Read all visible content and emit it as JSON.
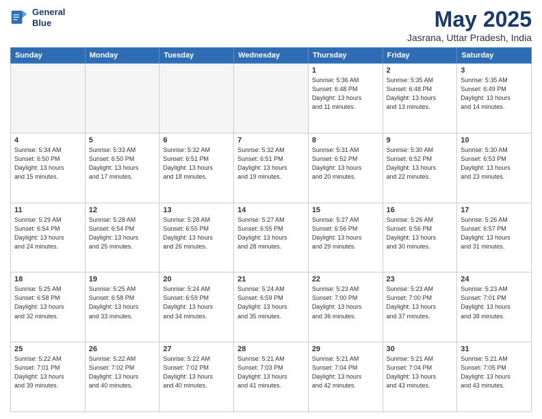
{
  "header": {
    "logo_line1": "General",
    "logo_line2": "Blue",
    "month": "May 2025",
    "location": "Jasrana, Uttar Pradesh, India"
  },
  "days_of_week": [
    "Sunday",
    "Monday",
    "Tuesday",
    "Wednesday",
    "Thursday",
    "Friday",
    "Saturday"
  ],
  "weeks": [
    [
      {
        "day": "",
        "empty": true
      },
      {
        "day": "",
        "empty": true
      },
      {
        "day": "",
        "empty": true
      },
      {
        "day": "",
        "empty": true
      },
      {
        "day": "1",
        "info": "Sunrise: 5:36 AM\nSunset: 6:48 PM\nDaylight: 13 hours\nand 11 minutes."
      },
      {
        "day": "2",
        "info": "Sunrise: 5:35 AM\nSunset: 6:48 PM\nDaylight: 13 hours\nand 13 minutes."
      },
      {
        "day": "3",
        "info": "Sunrise: 5:35 AM\nSunset: 6:49 PM\nDaylight: 13 hours\nand 14 minutes."
      }
    ],
    [
      {
        "day": "4",
        "info": "Sunrise: 5:34 AM\nSunset: 6:50 PM\nDaylight: 13 hours\nand 15 minutes."
      },
      {
        "day": "5",
        "info": "Sunrise: 5:33 AM\nSunset: 6:50 PM\nDaylight: 13 hours\nand 17 minutes."
      },
      {
        "day": "6",
        "info": "Sunrise: 5:32 AM\nSunset: 6:51 PM\nDaylight: 13 hours\nand 18 minutes."
      },
      {
        "day": "7",
        "info": "Sunrise: 5:32 AM\nSunset: 6:51 PM\nDaylight: 13 hours\nand 19 minutes."
      },
      {
        "day": "8",
        "info": "Sunrise: 5:31 AM\nSunset: 6:52 PM\nDaylight: 13 hours\nand 20 minutes."
      },
      {
        "day": "9",
        "info": "Sunrise: 5:30 AM\nSunset: 6:52 PM\nDaylight: 13 hours\nand 22 minutes."
      },
      {
        "day": "10",
        "info": "Sunrise: 5:30 AM\nSunset: 6:53 PM\nDaylight: 13 hours\nand 23 minutes."
      }
    ],
    [
      {
        "day": "11",
        "info": "Sunrise: 5:29 AM\nSunset: 6:54 PM\nDaylight: 13 hours\nand 24 minutes."
      },
      {
        "day": "12",
        "info": "Sunrise: 5:28 AM\nSunset: 6:54 PM\nDaylight: 13 hours\nand 25 minutes."
      },
      {
        "day": "13",
        "info": "Sunrise: 5:28 AM\nSunset: 6:55 PM\nDaylight: 13 hours\nand 26 minutes."
      },
      {
        "day": "14",
        "info": "Sunrise: 5:27 AM\nSunset: 6:55 PM\nDaylight: 13 hours\nand 28 minutes."
      },
      {
        "day": "15",
        "info": "Sunrise: 5:27 AM\nSunset: 6:56 PM\nDaylight: 13 hours\nand 29 minutes."
      },
      {
        "day": "16",
        "info": "Sunrise: 5:26 AM\nSunset: 6:56 PM\nDaylight: 13 hours\nand 30 minutes."
      },
      {
        "day": "17",
        "info": "Sunrise: 5:26 AM\nSunset: 6:57 PM\nDaylight: 13 hours\nand 31 minutes."
      }
    ],
    [
      {
        "day": "18",
        "info": "Sunrise: 5:25 AM\nSunset: 6:58 PM\nDaylight: 13 hours\nand 32 minutes."
      },
      {
        "day": "19",
        "info": "Sunrise: 5:25 AM\nSunset: 6:58 PM\nDaylight: 13 hours\nand 33 minutes."
      },
      {
        "day": "20",
        "info": "Sunrise: 5:24 AM\nSunset: 6:59 PM\nDaylight: 13 hours\nand 34 minutes."
      },
      {
        "day": "21",
        "info": "Sunrise: 5:24 AM\nSunset: 6:59 PM\nDaylight: 13 hours\nand 35 minutes."
      },
      {
        "day": "22",
        "info": "Sunrise: 5:23 AM\nSunset: 7:00 PM\nDaylight: 13 hours\nand 36 minutes."
      },
      {
        "day": "23",
        "info": "Sunrise: 5:23 AM\nSunset: 7:00 PM\nDaylight: 13 hours\nand 37 minutes."
      },
      {
        "day": "24",
        "info": "Sunrise: 5:23 AM\nSunset: 7:01 PM\nDaylight: 13 hours\nand 38 minutes."
      }
    ],
    [
      {
        "day": "25",
        "info": "Sunrise: 5:22 AM\nSunset: 7:01 PM\nDaylight: 13 hours\nand 39 minutes."
      },
      {
        "day": "26",
        "info": "Sunrise: 5:22 AM\nSunset: 7:02 PM\nDaylight: 13 hours\nand 40 minutes."
      },
      {
        "day": "27",
        "info": "Sunrise: 5:22 AM\nSunset: 7:02 PM\nDaylight: 13 hours\nand 40 minutes."
      },
      {
        "day": "28",
        "info": "Sunrise: 5:21 AM\nSunset: 7:03 PM\nDaylight: 13 hours\nand 41 minutes."
      },
      {
        "day": "29",
        "info": "Sunrise: 5:21 AM\nSunset: 7:04 PM\nDaylight: 13 hours\nand 42 minutes."
      },
      {
        "day": "30",
        "info": "Sunrise: 5:21 AM\nSunset: 7:04 PM\nDaylight: 13 hours\nand 43 minutes."
      },
      {
        "day": "31",
        "info": "Sunrise: 5:21 AM\nSunset: 7:05 PM\nDaylight: 13 hours\nand 43 minutes."
      }
    ]
  ]
}
